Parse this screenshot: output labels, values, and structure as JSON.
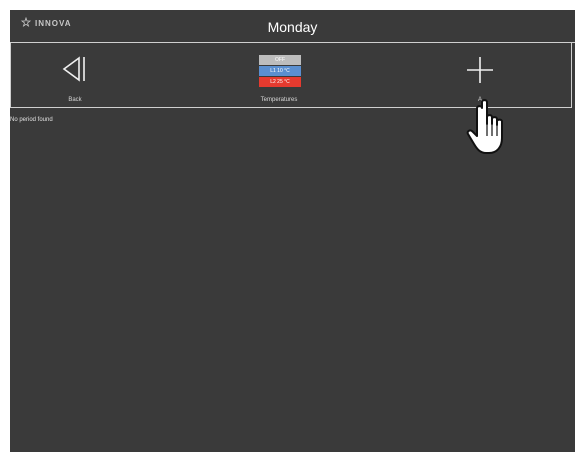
{
  "header": {
    "logo_text": "INNOVA",
    "title": "Monday"
  },
  "toolbar": {
    "back_label": "Back",
    "temperatures_label": "Temperatures",
    "add_label": "A",
    "temperatures": [
      {
        "label": "OFF",
        "color": "#bdbdbd"
      },
      {
        "label": "L1 10 °C",
        "color": "#5a8fd0"
      },
      {
        "label": "L2 25 °C",
        "color": "#e53a2f"
      }
    ]
  },
  "main": {
    "empty_message": "No period found"
  },
  "icons": {
    "back": "back-triangle-icon",
    "add": "plus-icon",
    "cursor": "hand-pointer-cursor",
    "logo": "innova-logo-icon"
  },
  "colors": {
    "background": "#3a3a3a",
    "text": "#ffffff",
    "divider": "#cfcfcf"
  }
}
